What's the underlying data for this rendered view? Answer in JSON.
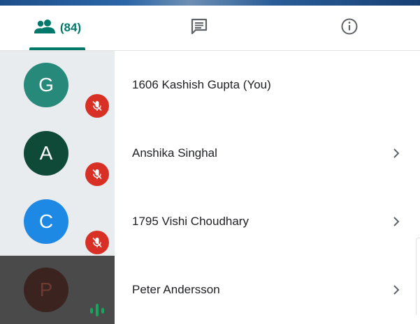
{
  "tabs": {
    "people": {
      "icon": "people-icon",
      "count": "(84)"
    },
    "chat": {
      "icon": "chat-icon"
    },
    "info": {
      "icon": "info-icon"
    }
  },
  "colors": {
    "accent": "#00796b",
    "mute_badge": "#d93025",
    "audio_indicator": "#1aa260"
  },
  "participants": [
    {
      "initial": "G",
      "name": "1606 Kashish Gupta (You)",
      "avatar_color": "#26897a",
      "status": "muted",
      "status_icon": "mic-off-icon"
    },
    {
      "initial": "A",
      "name": "Anshika Singhal",
      "avatar_color": "#0f4a39",
      "status": "muted",
      "status_icon": "mic-off-icon",
      "chevron": "chevron-right-icon"
    },
    {
      "initial": "C",
      "name": "1795 Vishi Choudhary",
      "avatar_color": "#1e88e5",
      "status": "muted",
      "status_icon": "mic-off-icon",
      "chevron": "chevron-right-icon"
    },
    {
      "initial": "P",
      "name": "Peter Andersson",
      "avatar_color": "#3b2420",
      "status": "speaking",
      "status_icon": "audio-level-icon",
      "chevron": "chevron-right-icon"
    }
  ]
}
